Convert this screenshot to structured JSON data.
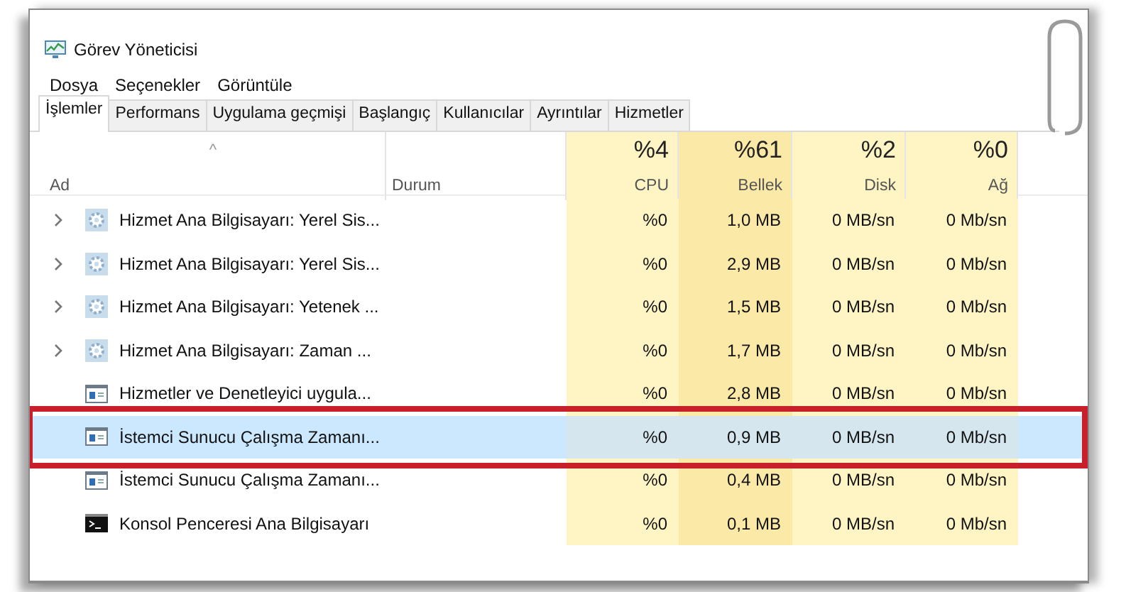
{
  "window": {
    "title": "Görev Yöneticisi"
  },
  "menu": [
    "Dosya",
    "Seçenekler",
    "Görüntüle"
  ],
  "tabs": [
    {
      "label": "İşlemler",
      "selected": true
    },
    {
      "label": "Performans",
      "selected": false
    },
    {
      "label": "Uygulama geçmişi",
      "selected": false
    },
    {
      "label": "Başlangıç",
      "selected": false
    },
    {
      "label": "Kullanıcılar",
      "selected": false
    },
    {
      "label": "Ayrıntılar",
      "selected": false
    },
    {
      "label": "Hizmetler",
      "selected": false
    }
  ],
  "table": {
    "sort_indicator": "^",
    "columns": [
      {
        "label": "Ad"
      },
      {
        "label": "Durum"
      },
      {
        "label": "CPU",
        "total": "%4"
      },
      {
        "label": "Bellek",
        "total": "%61"
      },
      {
        "label": "Disk",
        "total": "%2"
      },
      {
        "label": "Ağ",
        "total": "%0"
      }
    ],
    "rows": [
      {
        "kind": "service-group",
        "name": "Hizmet Ana Bilgisayarı: Yerel Sis...",
        "cpu": "%0",
        "memory": "1,0 MB",
        "disk": "0 MB/sn",
        "network": "0 Mb/sn",
        "selected": false,
        "framed": false
      },
      {
        "kind": "service-group",
        "name": "Hizmet Ana Bilgisayarı: Yerel Sis...",
        "cpu": "%0",
        "memory": "2,9 MB",
        "disk": "0 MB/sn",
        "network": "0 Mb/sn",
        "selected": false,
        "framed": false
      },
      {
        "kind": "service-group",
        "name": "Hizmet Ana Bilgisayarı: Yetenek ...",
        "cpu": "%0",
        "memory": "1,5 MB",
        "disk": "0 MB/sn",
        "network": "0 Mb/sn",
        "selected": false,
        "framed": false
      },
      {
        "kind": "service-group",
        "name": "Hizmet Ana Bilgisayarı: Zaman ...",
        "cpu": "%0",
        "memory": "1,7 MB",
        "disk": "0 MB/sn",
        "network": "0 Mb/sn",
        "selected": false,
        "framed": false
      },
      {
        "kind": "app",
        "name": "Hizmetler ve Denetleyici uygula...",
        "cpu": "%0",
        "memory": "2,8 MB",
        "disk": "0 MB/sn",
        "network": "0 Mb/sn",
        "selected": false,
        "framed": false
      },
      {
        "kind": "app",
        "name": "İstemci Sunucu Çalışma Zamanı...",
        "cpu": "%0",
        "memory": "0,9 MB",
        "disk": "0 MB/sn",
        "network": "0 Mb/sn",
        "selected": true,
        "framed": true
      },
      {
        "kind": "app",
        "name": "İstemci Sunucu Çalışma Zamanı...",
        "cpu": "%0",
        "memory": "0,4 MB",
        "disk": "0 MB/sn",
        "network": "0 Mb/sn",
        "selected": false,
        "framed": false
      },
      {
        "kind": "console",
        "name": "Konsol Penceresi Ana Bilgisayarı",
        "cpu": "%0",
        "memory": "0,1 MB",
        "disk": "0 MB/sn",
        "network": "0 Mb/sn",
        "selected": false,
        "framed": false
      }
    ]
  }
}
